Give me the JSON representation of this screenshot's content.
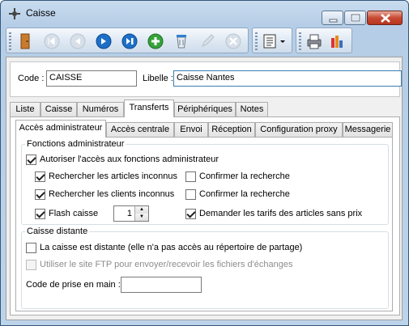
{
  "window": {
    "title": "Caisse"
  },
  "toolbar": {
    "buttons": [
      {
        "icon": "exit-door-icon"
      },
      {
        "icon": "first-record-icon"
      },
      {
        "icon": "previous-record-icon"
      },
      {
        "icon": "next-record-icon"
      },
      {
        "icon": "last-record-icon"
      },
      {
        "icon": "add-record-icon"
      },
      {
        "icon": "delete-record-icon"
      },
      {
        "icon": "edit-record-icon"
      },
      {
        "icon": "cancel-record-icon"
      },
      {
        "icon": "list-dropdown-icon"
      },
      {
        "icon": "print-icon"
      },
      {
        "icon": "statistics-icon"
      }
    ]
  },
  "header": {
    "code_label": "Code :",
    "code_value": "CAISSE",
    "libelle_label": "Libelle :",
    "libelle_value": "Caisse Nantes"
  },
  "tabs_main": [
    "Liste",
    "Caisse",
    "Numéros",
    "Transferts",
    "Périphériques",
    "Notes"
  ],
  "tabs_main_active": "Transferts",
  "tabs_sub": [
    "Accès administrateur",
    "Accès centrale",
    "Envoi",
    "Réception",
    "Configuration proxy",
    "Messagerie"
  ],
  "tabs_sub_active": "Accès administrateur",
  "admin": {
    "legend": "Fonctions administrateur",
    "allow_label": "Autoriser l'accès aux fonctions administrateur",
    "allow_checked": true,
    "search_articles_label": "Rechercher les articles inconnus",
    "search_articles_checked": true,
    "confirm1_label": "Confirmer la recherche",
    "confirm1_checked": false,
    "search_clients_label": "Rechercher les clients inconnus",
    "search_clients_checked": true,
    "confirm2_label": "Confirmer la recherche",
    "confirm2_checked": false,
    "flash_label": "Flash caisse",
    "flash_checked": true,
    "flash_value": "1",
    "tarifs_label": "Demander les tarifs des articles sans prix",
    "tarifs_checked": true
  },
  "remote": {
    "legend": "Caisse distante",
    "distante_label": "La caisse est distante (elle n'a pas accès au répertoire de partage)",
    "distante_checked": false,
    "ftp_label": "Utiliser le site FTP pour envoyer/recevoir les fichiers d'échanges",
    "ftp_checked": false,
    "ftp_disabled": true,
    "code_label": "Code de prise en main :",
    "code_value": ""
  }
}
